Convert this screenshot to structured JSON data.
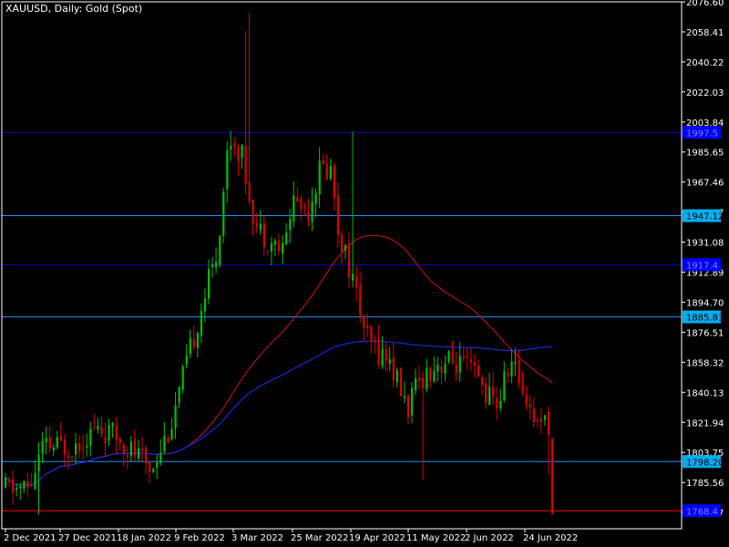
{
  "window": {
    "title": "XAUUSD, Daily:  Gold (Spot)"
  },
  "colors": {
    "background": "#000000",
    "frame": "#ffffff",
    "bull": "#00c000",
    "bear": "#e00000",
    "ma_fast": "#d01010",
    "ma_slow": "#1030ff",
    "level_blue": "#1e90ff",
    "level_navy": "#0000c8",
    "level_red": "#ff0000",
    "label_cyan_bg": "#00aeef",
    "label_navy_bg": "#0000ff"
  },
  "chart_data": {
    "type": "candlestick",
    "symbol": "XAUUSD",
    "timeframe": "Daily",
    "instrument": "Gold (Spot)",
    "y_ticks": [
      "2076.60",
      "2058.41",
      "2040.22",
      "2022.03",
      "2003.84",
      "1985.65",
      "1967.46",
      "1949.27",
      "1931.08",
      "1912.89",
      "1894.70",
      "1876.51",
      "1858.32",
      "1840.13",
      "1821.94",
      "1803.75",
      "1785.56",
      "1767.37"
    ],
    "x_ticks": [
      "2 Dec 2021",
      "27 Dec 2021",
      "18 Jan 2022",
      "9 Feb 2022",
      "3 Mar 2022",
      "25 Mar 2022",
      "19 Apr 2022",
      "11 May 2022",
      "2 Jun 2022",
      "24 Jun 2022"
    ],
    "ylim": [
      1757.5,
      2076.6
    ],
    "horizontal_levels": [
      {
        "price": 1997.5,
        "label": "1997.5",
        "style": "navy"
      },
      {
        "price": 1947.12,
        "label": "1947.12",
        "style": "cyan"
      },
      {
        "price": 1917.4,
        "label": "1917.4",
        "style": "navy"
      },
      {
        "price": 1885.81,
        "label": "1885.81",
        "style": "cyan"
      },
      {
        "price": 1798.2,
        "label": "1798.20",
        "style": "cyan"
      },
      {
        "price": 1768.4,
        "label": "1768.4",
        "style": "red"
      }
    ],
    "key_points": [
      {
        "date": "2 Dec 2021",
        "close": 1783
      },
      {
        "date": "27 Dec 2021",
        "close": 1808
      },
      {
        "date": "18 Jan 2022",
        "close": 1812
      },
      {
        "date": "9 Feb 2022",
        "close": 1833
      },
      {
        "date": "3 Mar 2022",
        "close": 1936
      },
      {
        "date": "8 Mar 2022",
        "high": 2070
      },
      {
        "date": "25 Mar 2022",
        "close": 1958
      },
      {
        "date": "18 Apr 2022",
        "high": 1998
      },
      {
        "date": "19 Apr 2022",
        "close": 1948
      },
      {
        "date": "11 May 2022",
        "close": 1853
      },
      {
        "date": "16 May 2022",
        "low": 1787
      },
      {
        "date": "2 Jun 2022",
        "close": 1868
      },
      {
        "date": "24 Jun 2022",
        "close": 1827
      },
      {
        "date": "last",
        "close": 1767
      }
    ],
    "series": [
      {
        "type": "moving_average",
        "color": "red"
      },
      {
        "type": "moving_average",
        "color": "blue"
      }
    ]
  }
}
